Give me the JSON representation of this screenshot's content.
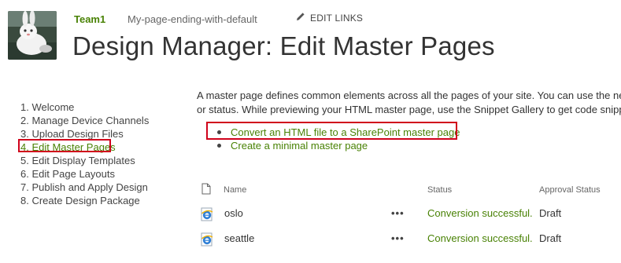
{
  "colors": {
    "accent_green": "#498205",
    "highlight_red": "#d0021b",
    "text_dark": "#333333"
  },
  "topnav": {
    "site_name": "Team1",
    "page_link": "My-page-ending-with-default",
    "edit_links": "EDIT LINKS",
    "edit_icon": "pencil-icon"
  },
  "page": {
    "title": "Design Manager: Edit Master Pages"
  },
  "steps": [
    {
      "label": "1. Welcome"
    },
    {
      "label": "2. Manage Device Channels"
    },
    {
      "label": "3. Upload Design Files"
    },
    {
      "label": "4. Edit Master Pages"
    },
    {
      "label": "5. Edit Display Templates"
    },
    {
      "label": "6. Edit Page Layouts"
    },
    {
      "label": "7. Publish and Apply Design"
    },
    {
      "label": "8. Create Design Package"
    }
  ],
  "intro": {
    "line1": "A master page defines common elements across all the pages of your site. You can use the net",
    "line2": "or status. While previewing your HTML master page, use the Snippet Gallery to get code snipp"
  },
  "actions": {
    "convert": "Convert an HTML file to a SharePoint master page",
    "minimal": "Create a minimal master page"
  },
  "table": {
    "columns": {
      "icon": "document-icon",
      "name": "Name",
      "status": "Status",
      "approval": "Approval Status"
    },
    "rows": [
      {
        "name": "oslo",
        "menu": "•••",
        "status": "Conversion successful.",
        "approval": "Draft",
        "icon": "ie-file-icon"
      },
      {
        "name": "seattle",
        "menu": "•••",
        "status": "Conversion successful.",
        "approval": "Draft",
        "icon": "ie-file-icon"
      }
    ]
  }
}
